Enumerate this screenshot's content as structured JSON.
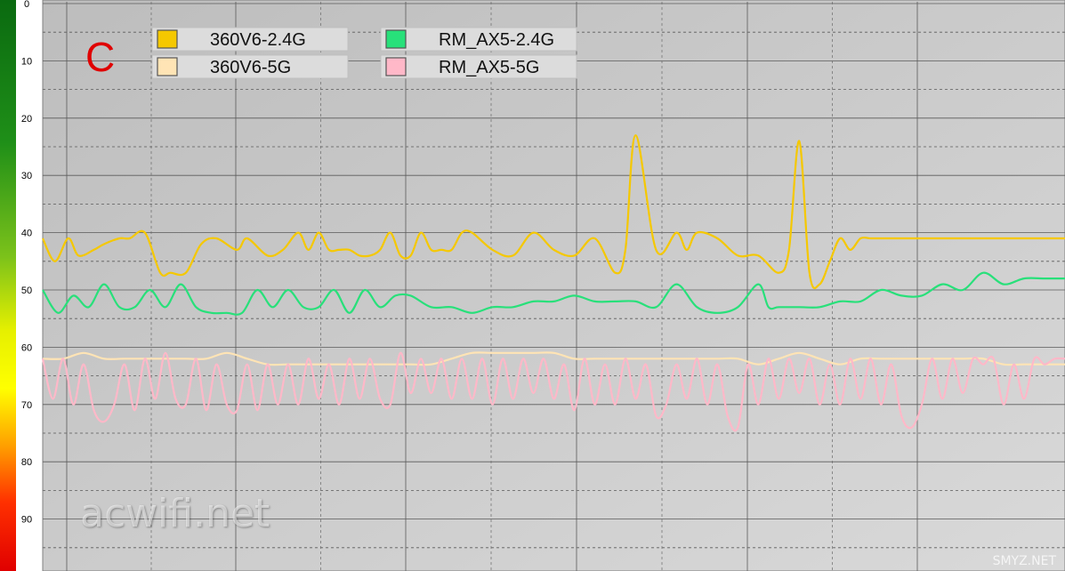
{
  "chart_data": {
    "type": "line",
    "panel_label": "C",
    "panel_label_color": "#e00000",
    "y_ticks": [
      "0",
      "10",
      "20",
      "30",
      "40",
      "50",
      "60",
      "70",
      "80",
      "90"
    ],
    "ylim": [
      0,
      99
    ],
    "y_inverted": true,
    "x_range": [
      0,
      100
    ],
    "grid": true,
    "legend_position": "top-left",
    "series": [
      {
        "name": "360V6-2.4G",
        "color": "#f5c800",
        "x": [
          0,
          1.2,
          2.5,
          3.5,
          5,
          6,
          7.5,
          8.5,
          10,
          11.5,
          12.5,
          14,
          15.5,
          17,
          19,
          20,
          22,
          23.5,
          25,
          26,
          27,
          28,
          29,
          30,
          31,
          32,
          33,
          34,
          35,
          36,
          37,
          38,
          39,
          40,
          41,
          42,
          44,
          46,
          48,
          50,
          52,
          54,
          56,
          57,
          58,
          60,
          62,
          63,
          64,
          66,
          68,
          70,
          72,
          73,
          74,
          75,
          76,
          77,
          78,
          79,
          80,
          81,
          82,
          83,
          84,
          85,
          86,
          87,
          88,
          89,
          90,
          91,
          92,
          93,
          94,
          95,
          96,
          97,
          98,
          99,
          100
        ],
        "y": [
          41,
          45,
          41,
          44,
          43,
          42,
          41,
          41,
          40,
          47,
          47,
          47,
          42,
          41,
          43,
          41,
          44,
          43,
          40,
          43,
          40,
          43,
          43,
          43,
          44,
          44,
          43,
          40,
          44,
          44,
          40,
          43,
          43,
          43,
          40,
          40,
          43,
          44,
          40,
          43,
          44,
          41,
          47,
          43,
          23,
          43,
          40,
          43,
          40,
          41,
          44,
          44,
          47,
          43,
          24,
          47,
          49,
          45,
          41,
          43,
          41,
          41,
          41,
          41,
          41,
          41,
          41,
          41,
          41,
          41,
          41,
          41,
          41,
          41,
          41,
          41,
          41,
          41,
          41,
          41,
          41
        ]
      },
      {
        "name": "360V6-5G",
        "color": "#ffe4b5",
        "x": [
          0,
          2,
          4,
          6,
          8,
          10,
          12,
          14,
          16,
          18,
          20,
          22,
          24,
          26,
          28,
          30,
          32,
          34,
          36,
          38,
          40,
          42,
          44,
          46,
          48,
          50,
          52,
          54,
          56,
          58,
          60,
          62,
          64,
          66,
          68,
          70,
          72,
          74,
          76,
          78,
          80,
          82,
          84,
          86,
          88,
          90,
          92,
          94,
          96,
          98,
          100
        ],
        "y": [
          62,
          62,
          61,
          62,
          62,
          62,
          62,
          62,
          62,
          61,
          62,
          63,
          63,
          63,
          63,
          63,
          63,
          63,
          63,
          63,
          62,
          61,
          61,
          61,
          61,
          61,
          62,
          62,
          62,
          62,
          62,
          62,
          62,
          62,
          62,
          63,
          62,
          61,
          62,
          63,
          62,
          62,
          62,
          62,
          62,
          62,
          62,
          63,
          63,
          63,
          63
        ]
      },
      {
        "name": "RM_AX5-2.4G",
        "color": "#28e07a",
        "x": [
          0,
          1.5,
          3,
          4.5,
          6,
          7.5,
          9,
          10.5,
          12,
          13.5,
          15,
          16.5,
          18,
          19.5,
          21,
          22.5,
          24,
          25.5,
          27,
          28.5,
          30,
          31.5,
          33,
          34.5,
          36,
          38,
          40,
          42,
          44,
          46,
          48,
          50,
          52,
          54,
          56,
          58,
          60,
          62,
          64,
          66,
          68,
          70,
          71,
          72,
          74,
          76,
          78,
          80,
          82,
          84,
          86,
          88,
          90,
          92,
          94,
          96,
          98,
          100
        ],
        "y": [
          50,
          54,
          51,
          53,
          49,
          53,
          53,
          50,
          53,
          49,
          53,
          54,
          54,
          54,
          50,
          53,
          50,
          53,
          53,
          50,
          54,
          50,
          53,
          51,
          51,
          53,
          53,
          54,
          53,
          53,
          52,
          52,
          51,
          52,
          52,
          52,
          53,
          49,
          53,
          54,
          53,
          49,
          53,
          53,
          53,
          53,
          52,
          52,
          50,
          51,
          51,
          49,
          50,
          47,
          49,
          48,
          48,
          48
        ]
      },
      {
        "name": "RM_AX5-5G",
        "color": "#ffb8c8",
        "x": [
          0,
          1,
          2,
          3,
          4,
          5,
          6,
          7,
          8,
          9,
          10,
          11,
          12,
          13,
          14,
          15,
          16,
          17,
          18,
          19,
          20,
          21,
          22,
          23,
          24,
          25,
          26,
          27,
          28,
          29,
          30,
          31,
          32,
          33,
          34,
          35,
          36,
          37,
          38,
          39,
          40,
          41,
          42,
          43,
          44,
          45,
          46,
          47,
          48,
          49,
          50,
          51,
          52,
          53,
          54,
          55,
          56,
          57,
          58,
          59,
          60,
          61,
          62,
          63,
          64,
          65,
          66,
          67,
          68,
          69,
          70,
          71,
          72,
          73,
          74,
          75,
          76,
          77,
          78,
          79,
          80,
          81,
          82,
          83,
          84,
          85,
          86,
          87,
          88,
          89,
          90,
          91,
          92,
          93,
          94,
          95,
          96,
          97,
          98,
          99,
          100
        ],
        "y": [
          62,
          69,
          62,
          70,
          63,
          71,
          73,
          70,
          63,
          71,
          62,
          69,
          61,
          69,
          70,
          62,
          71,
          63,
          70,
          71,
          63,
          71,
          63,
          70,
          63,
          70,
          62,
          69,
          63,
          70,
          62,
          69,
          62,
          69,
          70,
          61,
          68,
          62,
          68,
          62,
          69,
          62,
          69,
          62,
          70,
          62,
          69,
          62,
          68,
          62,
          69,
          63,
          71,
          62,
          70,
          63,
          70,
          62,
          69,
          63,
          72,
          70,
          63,
          69,
          62,
          70,
          63,
          72,
          74,
          63,
          70,
          62,
          69,
          62,
          68,
          62,
          70,
          63,
          70,
          62,
          69,
          62,
          70,
          63,
          72,
          74,
          70,
          62,
          69,
          62,
          68,
          62,
          63,
          62,
          70,
          63,
          69,
          62,
          63,
          62,
          62
        ]
      }
    ]
  },
  "watermark": "acwifi.net",
  "site_mark": "SMYZ.NET"
}
